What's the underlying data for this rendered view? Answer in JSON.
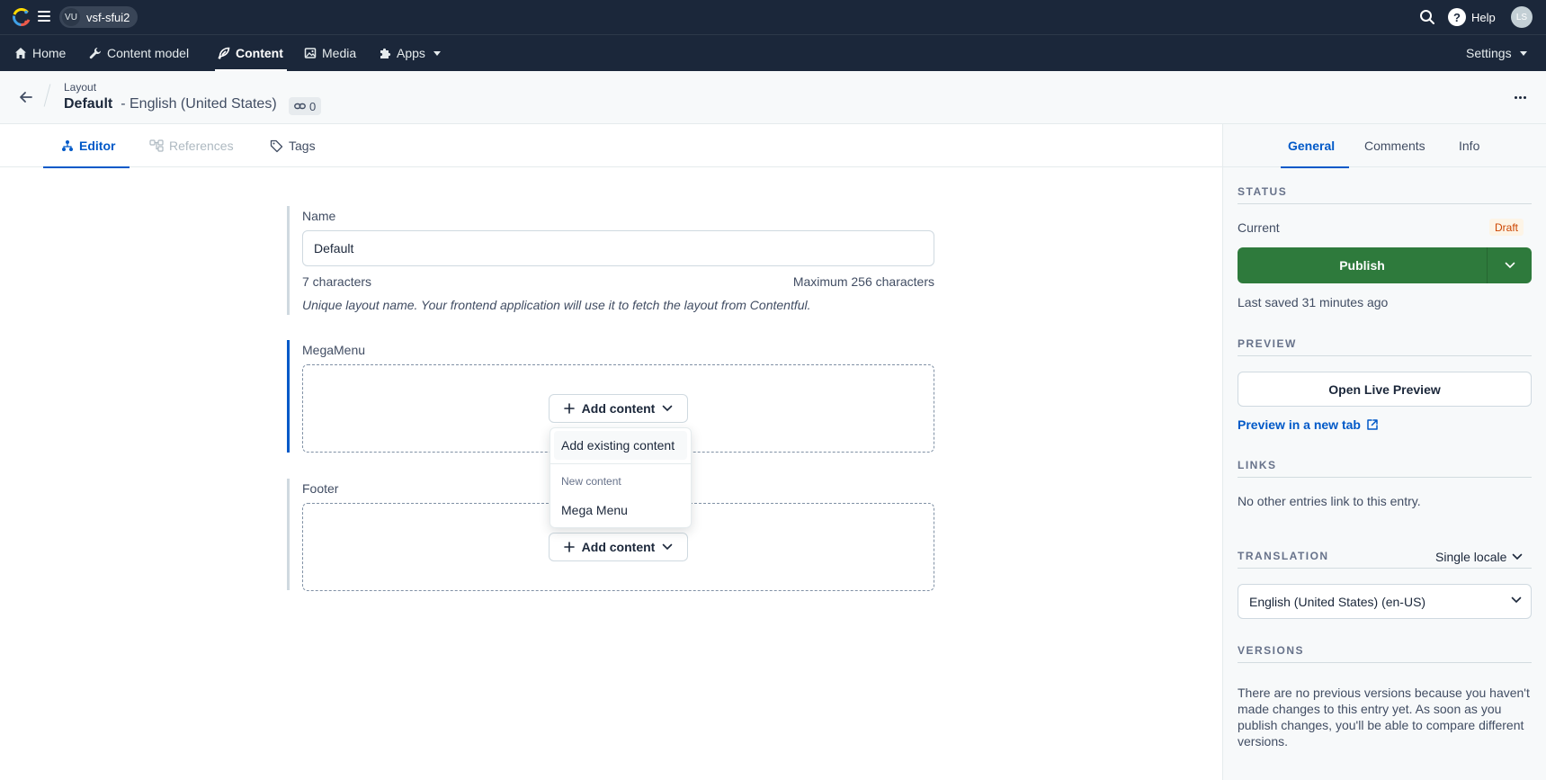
{
  "topbar": {
    "space_badge": "VU",
    "space_name": "vsf-sfui2",
    "help_label": "Help",
    "avatar_initials": "LS"
  },
  "nav": {
    "home": "Home",
    "content_model": "Content model",
    "content": "Content",
    "media": "Media",
    "apps": "Apps",
    "settings": "Settings"
  },
  "entry": {
    "content_type": "Layout",
    "title": "Default",
    "locale": "- English (United States)",
    "references_count": "0"
  },
  "editor_tabs": {
    "editor": "Editor",
    "references": "References",
    "tags": "Tags"
  },
  "fields": {
    "name": {
      "label": "Name",
      "value": "Default",
      "char_count": "7 characters",
      "max_chars": "Maximum 256 characters",
      "help": "Unique layout name. Your frontend application will use it to fetch the layout from Contentful."
    },
    "megamenu": {
      "label": "MegaMenu",
      "add_button": "Add content"
    },
    "footer": {
      "label": "Footer",
      "add_button": "Add content"
    }
  },
  "add_menu": {
    "add_existing": "Add existing content",
    "new_heading": "New content",
    "mega_menu": "Mega Menu"
  },
  "sidebar": {
    "tabs": {
      "general": "General",
      "comments": "Comments",
      "info": "Info"
    },
    "status": {
      "title": "STATUS",
      "current_label": "Current",
      "badge": "Draft",
      "publish_label": "Publish",
      "last_saved": "Last saved 31 minutes ago"
    },
    "preview": {
      "title": "PREVIEW",
      "open_live": "Open Live Preview",
      "new_tab": "Preview in a new tab"
    },
    "links": {
      "title": "LINKS",
      "text": "No other entries link to this entry."
    },
    "translation": {
      "title": "TRANSLATION",
      "mode": "Single locale",
      "locale": "English (United States) (en-US)"
    },
    "versions": {
      "title": "VERSIONS",
      "text": "There are no previous versions because you haven't made changes to this entry yet. As soon as you publish changes, you'll be able to compare different versions."
    }
  },
  "colors": {
    "nav_bg": "#1b273a",
    "accent": "#0059c8",
    "publish": "#2e7a3c",
    "draft_badge_bg": "#fdf4e6",
    "draft_badge_text": "#cc4500"
  },
  "icons": [
    "contentful-logo",
    "menu-icon",
    "search-icon",
    "help-icon",
    "home-icon",
    "wrench-icon",
    "feather-icon",
    "image-icon",
    "puzzle-icon",
    "arrow-left-icon",
    "link-icon",
    "more-icon",
    "editor-icon",
    "references-icon",
    "tag-icon",
    "plus-icon",
    "chevron-down-icon",
    "external-link-icon"
  ]
}
